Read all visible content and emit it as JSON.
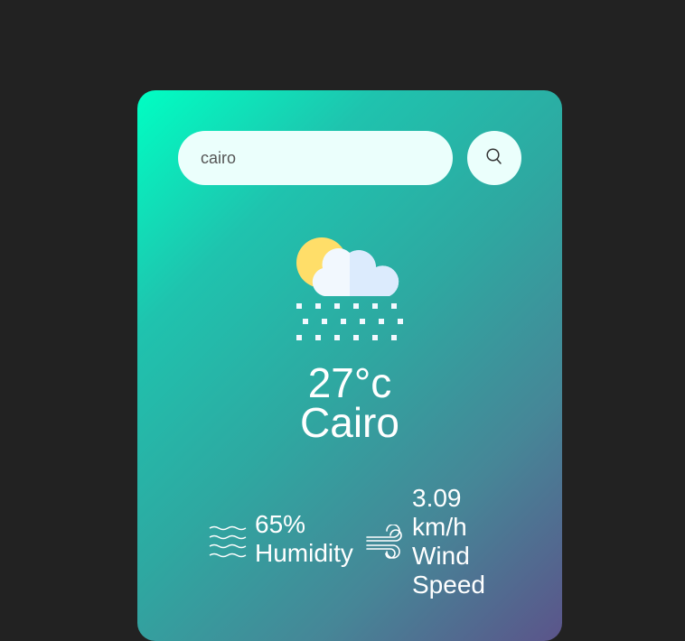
{
  "search": {
    "value": "cairo",
    "icon": "search-icon"
  },
  "weather": {
    "icon": "sun-cloud-snow-icon",
    "temperature": "27°c",
    "city": "Cairo"
  },
  "details": {
    "humidity_icon": "humidity-waves-icon",
    "humidity_value": "65%",
    "humidity_label": "Humidity",
    "wind_icon": "wind-icon",
    "wind_value": "3.09",
    "wind_unit": "km/h",
    "wind_label_1": "Wind",
    "wind_label_2": "Speed"
  },
  "colors": {
    "background": "#222222",
    "gradient_start": "#00ffc3",
    "gradient_end": "#5b548a",
    "input_bg": "#ebfffc"
  }
}
